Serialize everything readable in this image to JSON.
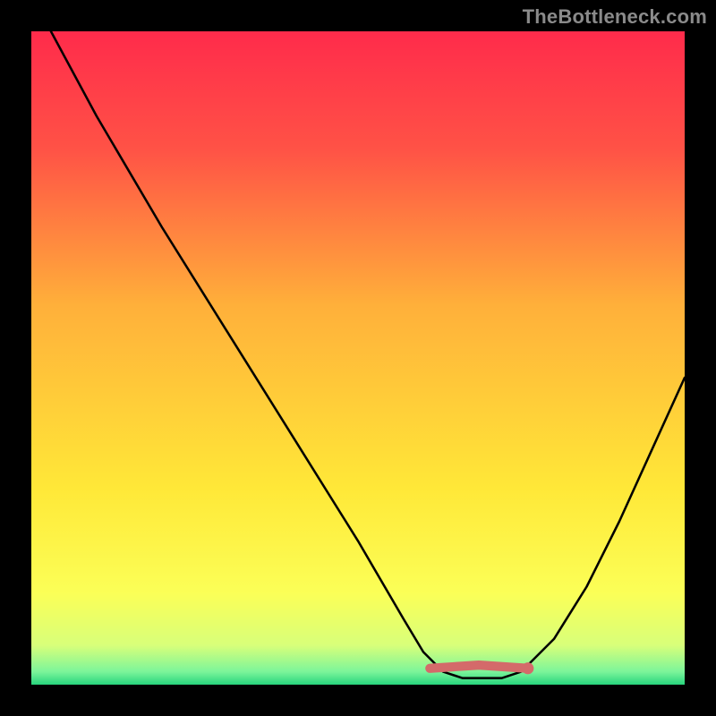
{
  "watermark": "TheBottleneck.com",
  "colors": {
    "gradient": [
      {
        "offset": "0%",
        "color": "#ff2b4b"
      },
      {
        "offset": "18%",
        "color": "#ff5246"
      },
      {
        "offset": "42%",
        "color": "#ffb03a"
      },
      {
        "offset": "70%",
        "color": "#ffe838"
      },
      {
        "offset": "86%",
        "color": "#fbff57"
      },
      {
        "offset": "94%",
        "color": "#d8ff7a"
      },
      {
        "offset": "98%",
        "color": "#7cf59a"
      },
      {
        "offset": "100%",
        "color": "#28d47d"
      }
    ],
    "curve": "#000000",
    "marker": "#d46a6a",
    "frame": "#000000"
  },
  "chart_data": {
    "type": "line",
    "title": "",
    "xlabel": "",
    "ylabel": "",
    "xlim": [
      0,
      100
    ],
    "ylim": [
      0,
      100
    ],
    "note": "y is bottleneck % (100 = worst at top, 0 = best at bottom). x is a normalized hardware balance axis. Values estimated from pixels.",
    "series": [
      {
        "name": "bottleneck-curve",
        "x": [
          3,
          10,
          20,
          30,
          40,
          50,
          57,
          60,
          63,
          66,
          69,
          72,
          75,
          80,
          85,
          90,
          95,
          100
        ],
        "y": [
          100,
          87,
          70,
          54,
          38,
          22,
          10,
          5,
          2,
          1,
          1,
          1,
          2,
          7,
          15,
          25,
          36,
          47
        ]
      }
    ],
    "optimal_band": {
      "x_start": 61,
      "x_end": 76,
      "y": 2.5
    },
    "optimal_point": {
      "x": 76,
      "y": 2.5
    }
  }
}
